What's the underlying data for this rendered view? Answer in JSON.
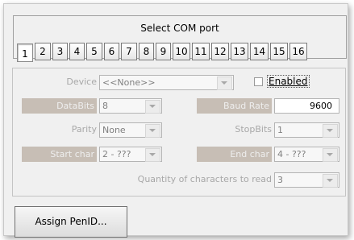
{
  "com_port": {
    "title": "Select COM port",
    "ports": [
      "1",
      "2",
      "3",
      "4",
      "5",
      "6",
      "7",
      "8",
      "9",
      "10",
      "11",
      "12",
      "13",
      "14",
      "15",
      "16"
    ],
    "selected": "1"
  },
  "settings": {
    "device_label": "Device",
    "device_value": "<<None>>",
    "enabled_label": "Enabled",
    "enabled_checked": false,
    "databits_label": "DataBits",
    "databits_value": "8",
    "baud_label": "Baud Rate",
    "baud_value": "9600",
    "parity_label": "Parity",
    "parity_value": "None",
    "stopbits_label": "StopBits",
    "stopbits_value": "1",
    "start_char_label": "Start char",
    "start_char_value": "2  - ???",
    "end_char_label": "End char",
    "end_char_value": "4  - ???",
    "quantity_label": "Quantity of characters to read",
    "quantity_value": "3"
  },
  "assign_button_label": "Assign PenID..."
}
